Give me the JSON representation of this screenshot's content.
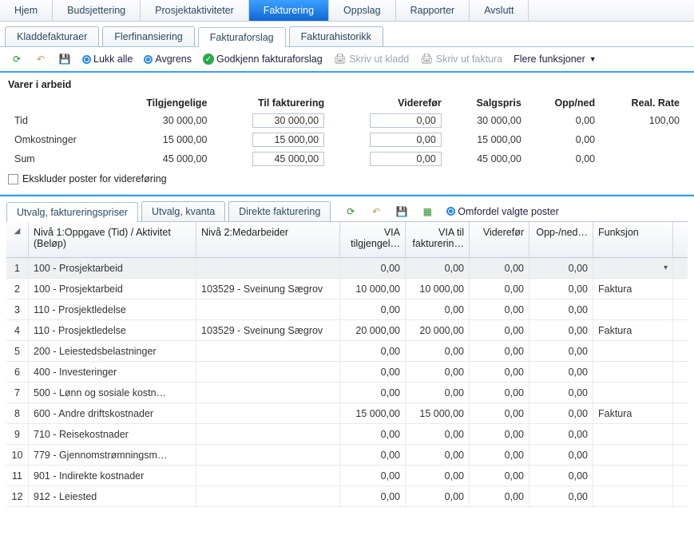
{
  "mainTabs": [
    "Hjem",
    "Budsjettering",
    "Prosjektaktiviteter",
    "Fakturering",
    "Oppslag",
    "Rapporter",
    "Avslutt"
  ],
  "mainActive": 3,
  "subTabs": [
    "Kladdefakturaer",
    "Flerfinansiering",
    "Fakturaforslag",
    "Fakturahistorikk"
  ],
  "subActive": 2,
  "toolbar": {
    "lukk": "Lukk alle",
    "avgrens": "Avgrens",
    "godkjenn": "Godkjenn fakturaforslag",
    "skrivKladd": "Skriv ut kladd",
    "skrivFaktura": "Skriv ut faktura",
    "flere": "Flere funksjoner"
  },
  "panel": {
    "title": "Varer i arbeid",
    "cols": [
      "",
      "Tilgjengelige",
      "Til fakturering",
      "Viderefør",
      "Salgspris",
      "Opp/ned",
      "Real. Rate"
    ],
    "rows": [
      {
        "label": "Tid",
        "tilg": "30 000,00",
        "tilf": "30 000,00",
        "vid": "0,00",
        "salg": "30 000,00",
        "opp": "0,00",
        "rate": "100,00"
      },
      {
        "label": "Omkostninger",
        "tilg": "15 000,00",
        "tilf": "15 000,00",
        "vid": "0,00",
        "salg": "15 000,00",
        "opp": "0,00",
        "rate": ""
      },
      {
        "label": "Sum",
        "tilg": "45 000,00",
        "tilf": "45 000,00",
        "vid": "0,00",
        "salg": "45 000,00",
        "opp": "0,00",
        "rate": ""
      }
    ],
    "chk": "Ekskluder poster for videreføring"
  },
  "bTabs": [
    "Utvalg, faktureringspriser",
    "Utvalg, kvanta",
    "Direkte fakturering"
  ],
  "bActive": 0,
  "omfordel": "Omfordel valgte poster",
  "gridCols": {
    "level1": "Nivå 1:Oppgave (Tid) / Aktivitet (Beløp)",
    "level2": "Nivå 2:Medarbeider",
    "via1": "VIA tilgjengel…",
    "via2": "VIA til fakturerin…",
    "vid": "Viderefør",
    "opp": "Opp-/ned…",
    "funk": "Funksjon"
  },
  "gridRows": [
    {
      "n": "1",
      "l1": "100 - Prosjektarbeid",
      "l2": "",
      "v1": "0,00",
      "v2": "0,00",
      "vid": "0,00",
      "opp": "0,00",
      "fk": "",
      "sel": true,
      "caret": true
    },
    {
      "n": "2",
      "l1": "100 - Prosjektarbeid",
      "l2": "103529 - Sveinung Sægrov",
      "v1": "10 000,00",
      "v2": "10 000,00",
      "vid": "0,00",
      "opp": "0,00",
      "fk": "Faktura"
    },
    {
      "n": "3",
      "l1": "110 - Prosjektledelse",
      "l2": "",
      "v1": "0,00",
      "v2": "0,00",
      "vid": "0,00",
      "opp": "0,00",
      "fk": ""
    },
    {
      "n": "4",
      "l1": "110 - Prosjektledelse",
      "l2": "103529 - Sveinung Sægrov",
      "v1": "20 000,00",
      "v2": "20 000,00",
      "vid": "0,00",
      "opp": "0,00",
      "fk": "Faktura"
    },
    {
      "n": "5",
      "l1": "200 - Leiestedsbelastninger",
      "l2": "",
      "v1": "0,00",
      "v2": "0,00",
      "vid": "0,00",
      "opp": "0,00",
      "fk": ""
    },
    {
      "n": "6",
      "l1": "400 - Investeringer",
      "l2": "",
      "v1": "0,00",
      "v2": "0,00",
      "vid": "0,00",
      "opp": "0,00",
      "fk": ""
    },
    {
      "n": "7",
      "l1": "500 - Lønn og sosiale kostn…",
      "l2": "",
      "v1": "0,00",
      "v2": "0,00",
      "vid": "0,00",
      "opp": "0,00",
      "fk": ""
    },
    {
      "n": "8",
      "l1": "600 - Andre driftskostnader",
      "l2": "",
      "v1": "15 000,00",
      "v2": "15 000,00",
      "vid": "0,00",
      "opp": "0,00",
      "fk": "Faktura"
    },
    {
      "n": "9",
      "l1": "710 - Reisekostnader",
      "l2": "",
      "v1": "0,00",
      "v2": "0,00",
      "vid": "0,00",
      "opp": "0,00",
      "fk": ""
    },
    {
      "n": "10",
      "l1": "779 - Gjennomstrømningsm…",
      "l2": "",
      "v1": "0,00",
      "v2": "0,00",
      "vid": "0,00",
      "opp": "0,00",
      "fk": ""
    },
    {
      "n": "11",
      "l1": "901 - Indirekte kostnader",
      "l2": "",
      "v1": "0,00",
      "v2": "0,00",
      "vid": "0,00",
      "opp": "0,00",
      "fk": ""
    },
    {
      "n": "12",
      "l1": "912 - Leiested",
      "l2": "",
      "v1": "0,00",
      "v2": "0,00",
      "vid": "0,00",
      "opp": "0,00",
      "fk": ""
    }
  ]
}
